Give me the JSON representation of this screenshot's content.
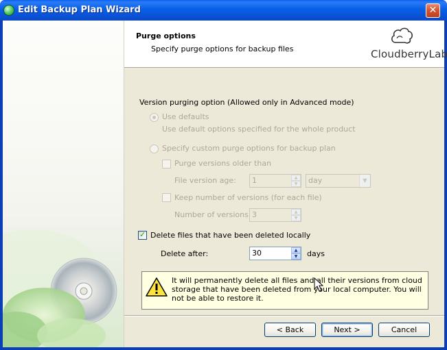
{
  "window": {
    "title": "Edit Backup Plan Wizard"
  },
  "header": {
    "title": "Purge options",
    "subtitle": "Specify purge options for backup files",
    "logo_text": "CloudberryLab"
  },
  "options": {
    "group_label": "Version purging option (Allowed only in Advanced mode)",
    "use_defaults": {
      "label": "Use defaults",
      "description": "Use default options specified for the whole product",
      "checked": true,
      "enabled": false
    },
    "custom": {
      "label": "Specify custom purge options for backup plan",
      "checked": false,
      "enabled": false
    },
    "purge_older": {
      "label": "Purge versions older than",
      "checked": false,
      "enabled": false
    },
    "file_version_age": {
      "label": "File version age:",
      "value": "1",
      "unit": "day"
    },
    "keep_number": {
      "label": "Keep number of versions (for each file)",
      "checked": false,
      "enabled": false
    },
    "number_of_versions": {
      "label": "Number of versions:",
      "value": "3"
    },
    "delete_local": {
      "label": "Delete files that have been deleted locally",
      "checked": true,
      "enabled": true
    },
    "delete_after": {
      "label": "Delete after:",
      "value": "30",
      "unit": "days"
    }
  },
  "warning": {
    "text": "It will permanently delete all files and all their versions from cloud storage that have been deleted from your local computer. You will not be able to restore it."
  },
  "buttons": {
    "back": "< Back",
    "next": "Next >",
    "cancel": "Cancel"
  },
  "icons": {
    "app": "app-icon",
    "close": "close-icon",
    "logo": "cloud-logo-icon",
    "warning": "warning-icon",
    "spin_up": "arrow-up-icon",
    "spin_down": "arrow-down-icon",
    "dropdown": "chevron-down-icon",
    "cursor": "mouse-pointer-icon"
  }
}
